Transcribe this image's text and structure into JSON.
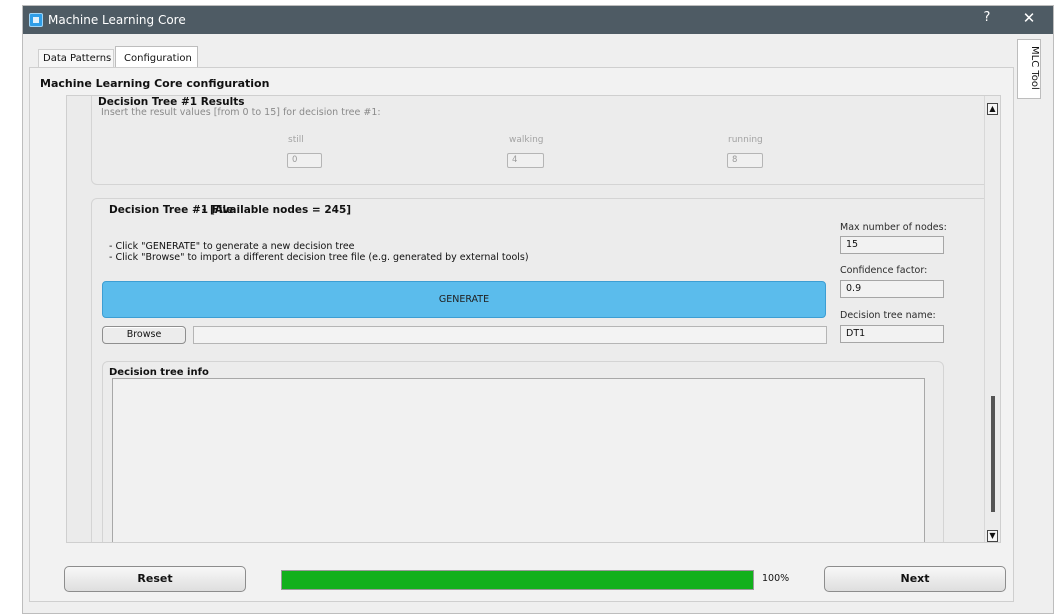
{
  "window": {
    "title": "Machine Learning Core",
    "help_label": "?",
    "close_label": "✕"
  },
  "tabs": [
    {
      "label": "Data Patterns",
      "selected": false
    },
    {
      "label": "Configuration",
      "selected": true
    }
  ],
  "side_tab": {
    "label": "MLC Tool"
  },
  "main": {
    "section_title": "Machine Learning Core configuration",
    "results": {
      "title": "Decision Tree #1 Results",
      "description": "Insert the result values [from 0 to 15] for decision tree #1:",
      "items": [
        {
          "label": "still",
          "value": "0"
        },
        {
          "label": "walking",
          "value": "4"
        },
        {
          "label": "running",
          "value": "8"
        }
      ]
    },
    "file": {
      "title": "Decision Tree #1 File",
      "nodes_text": "-   [Available nodes = 245]",
      "instructions": [
        "- Click \"GENERATE\" to generate a new decision tree",
        "- Click \"Browse\" to import a different decision tree file (e.g. generated by external tools)"
      ],
      "generate_label": "GENERATE",
      "browse_label": "Browse",
      "browse_path": "",
      "max_nodes_label": "Max number of nodes:",
      "max_nodes_value": "15",
      "confidence_label": "Confidence factor:",
      "confidence_value": "0.9",
      "tree_name_label": "Decision tree name:",
      "tree_name_value": "DT1"
    },
    "info": {
      "title": "Decision tree info",
      "content": ""
    },
    "scroll": {
      "up_icon": "▲",
      "down_icon": "▼"
    }
  },
  "footer": {
    "reset_label": "Reset",
    "progress": 100,
    "progress_label": "100%",
    "progress_color": "#12b01c",
    "next_label": "Next"
  },
  "colors": {
    "titlebar": "#4e5b64",
    "generate_button": "#5bbcec"
  }
}
